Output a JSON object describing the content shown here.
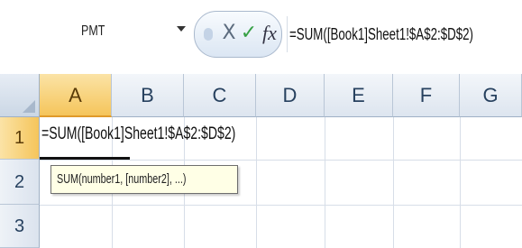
{
  "name_box": {
    "value": "PMT"
  },
  "formula_bar": {
    "cancel_symbol": "X",
    "enter_symbol": "✓",
    "fx_symbol": "fx",
    "formula": "=SUM([Book1]Sheet1!$A$2:$D$2)"
  },
  "columns": [
    "A",
    "B",
    "C",
    "D",
    "E",
    "F",
    "G"
  ],
  "rows": [
    "1",
    "2",
    "3"
  ],
  "cells": {
    "A1": "=SUM([Book1]Sheet1!$A$2:$D$2)"
  },
  "tooltip": {
    "text": "SUM(number1, [number2], ...)"
  },
  "colors": {
    "active_header": "#f5c55b",
    "header": "#dde5ef",
    "tooltip_bg": "#ffffe6",
    "enter_green": "#36a044"
  }
}
